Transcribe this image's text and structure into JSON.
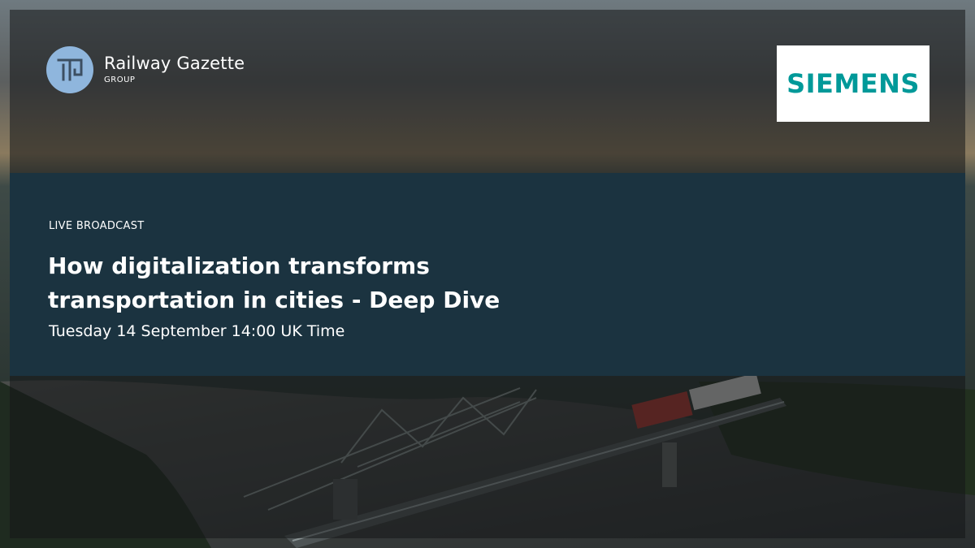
{
  "brand": {
    "name": "Railway Gazette",
    "sub": "GROUP",
    "logo_icon": "railway-gazette-logo-icon",
    "logo_color": "#8fb6dd"
  },
  "sponsor": {
    "name": "SIEMENS",
    "color": "#009999"
  },
  "event": {
    "kicker": "LIVE BROADCAST",
    "title": "How digitalization transforms transportation in cities - Deep Dive",
    "datetime": "Tuesday 14 September 14:00 UK Time"
  },
  "colors": {
    "panel": "#1b3340",
    "frame_overlay": "#141618"
  }
}
